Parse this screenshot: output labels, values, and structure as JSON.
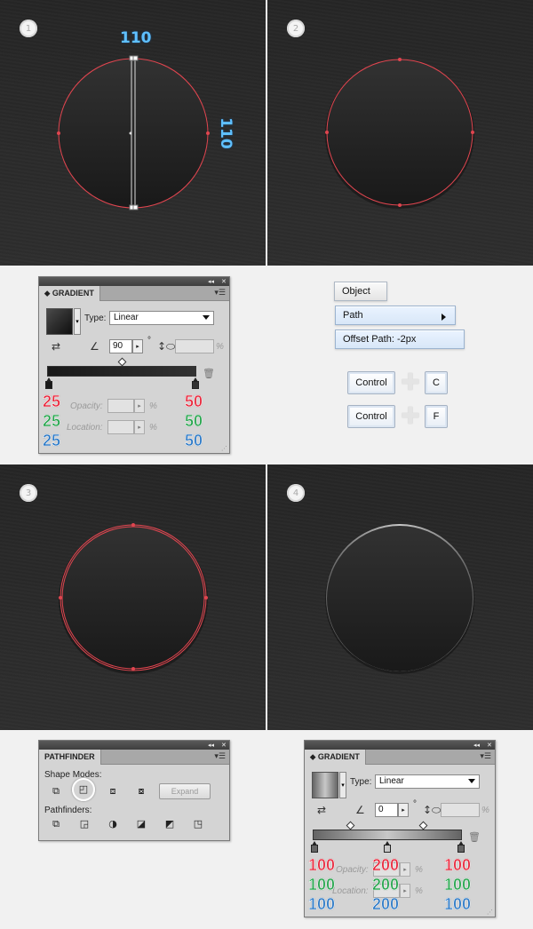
{
  "steps": {
    "step1": {
      "badge": "1",
      "width_label": "110",
      "height_label": "110"
    },
    "step2": {
      "badge": "2"
    },
    "step3": {
      "badge": "3"
    },
    "step4": {
      "badge": "4"
    }
  },
  "gradient_panel_1": {
    "collapse": "◂◂",
    "close": "✕",
    "tab": "GRADIENT",
    "menu": "▾☰",
    "type_label": "Type:",
    "type_value": "Linear",
    "angle_value": "90",
    "degree": "°",
    "percent": "%",
    "opacity_label": "Opacity:",
    "location_label": "Location:",
    "left_stop": {
      "r": "25",
      "g": "25",
      "b": "25"
    },
    "right_stop": {
      "r": "50",
      "g": "50",
      "b": "50"
    }
  },
  "menu": {
    "object": "Object",
    "path": "Path",
    "offset_path": "Offset Path: -2px"
  },
  "shortcuts": {
    "copy": {
      "modifier": "Control",
      "plus": "✚",
      "key": "C"
    },
    "paste_front": {
      "modifier": "Control",
      "plus": "✚",
      "key": "F"
    }
  },
  "pathfinder_panel": {
    "collapse": "◂◂",
    "close": "✕",
    "tab": "PATHFINDER",
    "menu": "▾☰",
    "shape_modes_label": "Shape Modes:",
    "expand_label": "Expand",
    "pathfinders_label": "Pathfinders:"
  },
  "gradient_panel_2": {
    "collapse": "◂◂",
    "close": "✕",
    "tab": "GRADIENT",
    "menu": "▾☰",
    "type_label": "Type:",
    "type_value": "Linear",
    "angle_value": "0",
    "degree": "°",
    "percent": "%",
    "opacity_label": "Opacity:",
    "location_label": "Location:",
    "left_stop": {
      "r": "100",
      "g": "100",
      "b": "100"
    },
    "mid_stop": {
      "r": "200",
      "g": "200",
      "b": "200"
    },
    "right_stop": {
      "r": "100",
      "g": "100",
      "b": "100"
    }
  },
  "colors": {
    "dim_blue": "#5fc0ff",
    "path_red": "#e0454f",
    "red": "#e8253a",
    "green": "#22a44a",
    "blue": "#2a78c6"
  }
}
